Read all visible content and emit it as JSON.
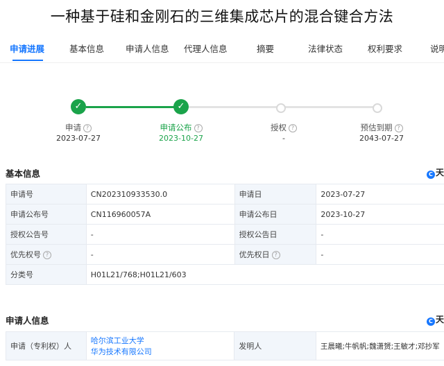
{
  "title": "一种基于硅和金刚石的三维集成芯片的混合键合方法",
  "tabs": [
    "申请进展",
    "基本信息",
    "申请人信息",
    "代理人信息",
    "摘要",
    "法律状态",
    "权利要求",
    "说明"
  ],
  "progress": {
    "steps": [
      {
        "label": "申请",
        "date": "2023-07-27",
        "state": "done"
      },
      {
        "label": "申请公布",
        "date": "2023-10-27",
        "state": "done"
      },
      {
        "label": "授权",
        "date": "-",
        "state": "todo"
      },
      {
        "label": "预估到期",
        "date": "2043-07-27",
        "state": "todo"
      }
    ]
  },
  "basic": {
    "title": "基本信息",
    "brand": "天",
    "rows": [
      {
        "k1": "申请号",
        "v1": "CN202310933530.0",
        "k2": "申请日",
        "v2": "2023-07-27"
      },
      {
        "k1": "申请公布号",
        "v1": "CN116960057A",
        "k2": "申请公布日",
        "v2": "2023-10-27"
      },
      {
        "k1": "授权公告号",
        "v1": "-",
        "k2": "授权公告日",
        "v2": "-"
      },
      {
        "k1": "优先权号",
        "v1": "-",
        "k2": "优先权日",
        "v2": "-"
      },
      {
        "k1": "分类号",
        "v1": "H01L21/768;H01L21/603"
      }
    ]
  },
  "applicant": {
    "title": "申请人信息",
    "brand": "天",
    "key": "申请（专利权）人",
    "applicants": [
      "哈尔滨工业大学",
      "华为技术有限公司"
    ],
    "inventor_key": "发明人",
    "inventors": "王晨曦;牛帆帆;魏潇赟;王敏才;邓抄军"
  }
}
